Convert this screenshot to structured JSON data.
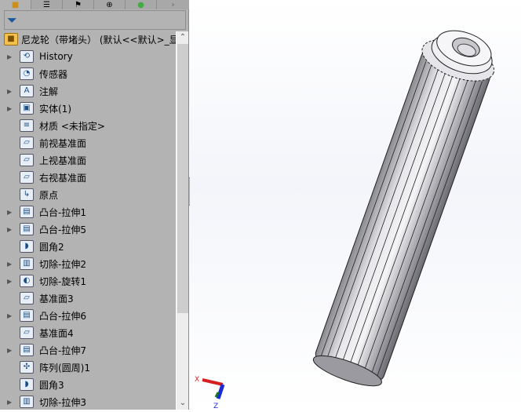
{
  "tabs": [
    {
      "icon": "feature-manager-icon"
    },
    {
      "icon": "property-manager-icon"
    },
    {
      "icon": "configuration-manager-icon"
    },
    {
      "icon": "dimxpert-icon"
    },
    {
      "icon": "display-manager-icon"
    }
  ],
  "filter": {
    "icon": "filter-icon"
  },
  "tree": {
    "root": "尼龙轮（带堵头） (默认<<默认>_显",
    "items": [
      {
        "label": "History",
        "icon": "history-folder-icon",
        "expandable": true
      },
      {
        "label": "传感器",
        "icon": "sensors-folder-icon",
        "expandable": false
      },
      {
        "label": "注解",
        "icon": "annotations-folder-icon",
        "expandable": true
      },
      {
        "label": "实体(1)",
        "icon": "solid-bodies-folder-icon",
        "expandable": true
      },
      {
        "label": "材质 <未指定>",
        "icon": "material-icon",
        "expandable": false
      },
      {
        "label": "前视基准面",
        "icon": "plane-icon",
        "expandable": false
      },
      {
        "label": "上视基准面",
        "icon": "plane-icon",
        "expandable": false
      },
      {
        "label": "右视基准面",
        "icon": "plane-icon",
        "expandable": false
      },
      {
        "label": "原点",
        "icon": "origin-icon",
        "expandable": false
      },
      {
        "label": "凸台-拉伸1",
        "icon": "boss-extrude-icon",
        "expandable": true
      },
      {
        "label": "凸台-拉伸5",
        "icon": "boss-extrude-icon",
        "expandable": true
      },
      {
        "label": "圆角2",
        "icon": "fillet-icon",
        "expandable": false
      },
      {
        "label": "切除-拉伸2",
        "icon": "cut-extrude-icon",
        "expandable": true
      },
      {
        "label": "切除-旋转1",
        "icon": "cut-revolve-icon",
        "expandable": true
      },
      {
        "label": "基准面3",
        "icon": "plane-icon",
        "expandable": false
      },
      {
        "label": "凸台-拉伸6",
        "icon": "boss-extrude-icon",
        "expandable": true
      },
      {
        "label": "基准面4",
        "icon": "plane-icon",
        "expandable": false
      },
      {
        "label": "凸台-拉伸7",
        "icon": "boss-extrude-icon",
        "expandable": true
      },
      {
        "label": "阵列(圆周)1",
        "icon": "circular-pattern-icon",
        "expandable": false
      },
      {
        "label": "圆角3",
        "icon": "fillet-icon",
        "expandable": false
      },
      {
        "label": "切除-拉伸3",
        "icon": "cut-extrude-icon",
        "expandable": true
      }
    ]
  },
  "triad": {
    "x_label": "X",
    "z_label": "Z",
    "x_color": "#d42020",
    "y_color": "#1a7a1a",
    "z_color": "#1a2ad4"
  }
}
